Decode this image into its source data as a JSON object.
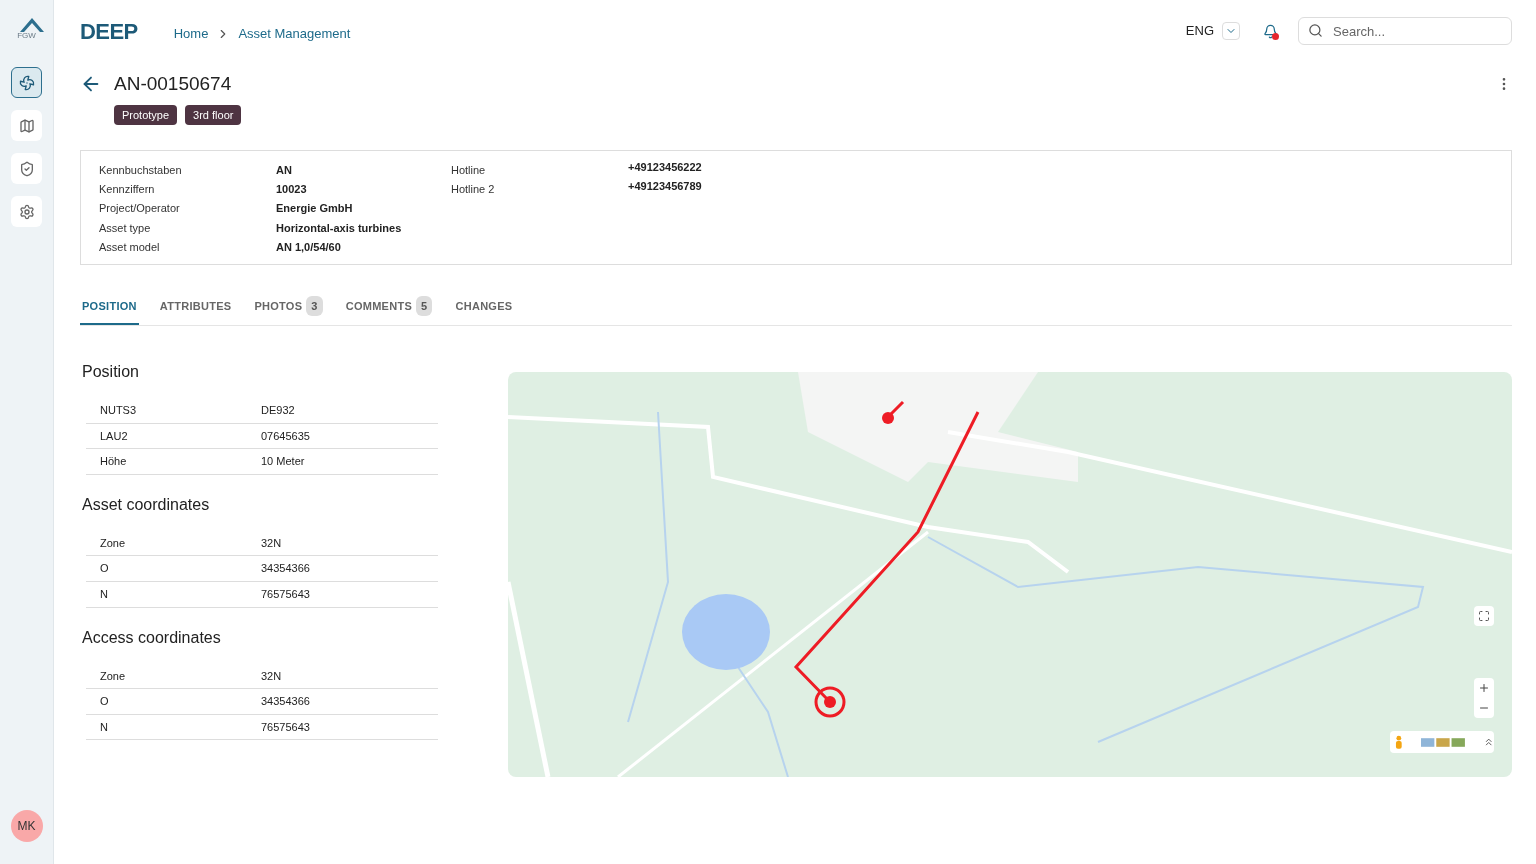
{
  "brand": {
    "logo_text": "FGW",
    "name": "DEEP"
  },
  "breadcrumb": [
    "Home",
    "Asset Management"
  ],
  "language": "ENG",
  "notifications": {
    "unread": true
  },
  "search": {
    "placeholder": "Search..."
  },
  "sidebar": {
    "items": [
      {
        "kind": "turbine",
        "selected": true
      },
      {
        "kind": "map",
        "selected": false
      },
      {
        "kind": "shield",
        "selected": false
      },
      {
        "kind": "settings",
        "selected": false
      }
    ],
    "user_initials": "MK"
  },
  "asset": {
    "id": "AN-00150674",
    "tags": [
      "Prototype",
      "3rd floor"
    ]
  },
  "details": {
    "left": [
      {
        "label": "Kennbuchstaben",
        "value": "AN"
      },
      {
        "label": "Kennziffern",
        "value": "10023"
      },
      {
        "label": "Project/Operator",
        "value": "Energie  GmbH"
      },
      {
        "label": "Asset type",
        "value": "Horizontal-axis turbines"
      },
      {
        "label": "Asset model",
        "value": "AN 1,0/54/60"
      }
    ],
    "right": [
      {
        "label": "Hotline",
        "value": "+49123456222"
      },
      {
        "label": "Hotline 2",
        "value": "+49123456789"
      }
    ]
  },
  "tabs": [
    {
      "label": "POSITION",
      "selected": true
    },
    {
      "label": "ATTRIBUTES",
      "selected": false
    },
    {
      "label": "PHOTOS",
      "count": "3",
      "selected": false
    },
    {
      "label": "COMMENTS",
      "count": "5",
      "selected": false
    },
    {
      "label": "CHANGES",
      "selected": false
    }
  ],
  "sections": [
    {
      "title": "Position",
      "rows": [
        {
          "label": "NUTS3",
          "value": "DE932"
        },
        {
          "label": "LAU2",
          "value": "07645635"
        },
        {
          "label": "Höhe",
          "value": "10 Meter"
        }
      ]
    },
    {
      "title": "Asset coordinates",
      "rows": [
        {
          "label": "Zone",
          "value": "32N"
        },
        {
          "label": "O",
          "value": "34354366"
        },
        {
          "label": "N",
          "value": "76575643"
        }
      ]
    },
    {
      "title": "Access coordinates",
      "rows": [
        {
          "label": "Zone",
          "value": "32N"
        },
        {
          "label": "O",
          "value": "34354366"
        },
        {
          "label": "N",
          "value": "76575643"
        }
      ]
    }
  ],
  "map": {
    "kind": "picture"
  }
}
